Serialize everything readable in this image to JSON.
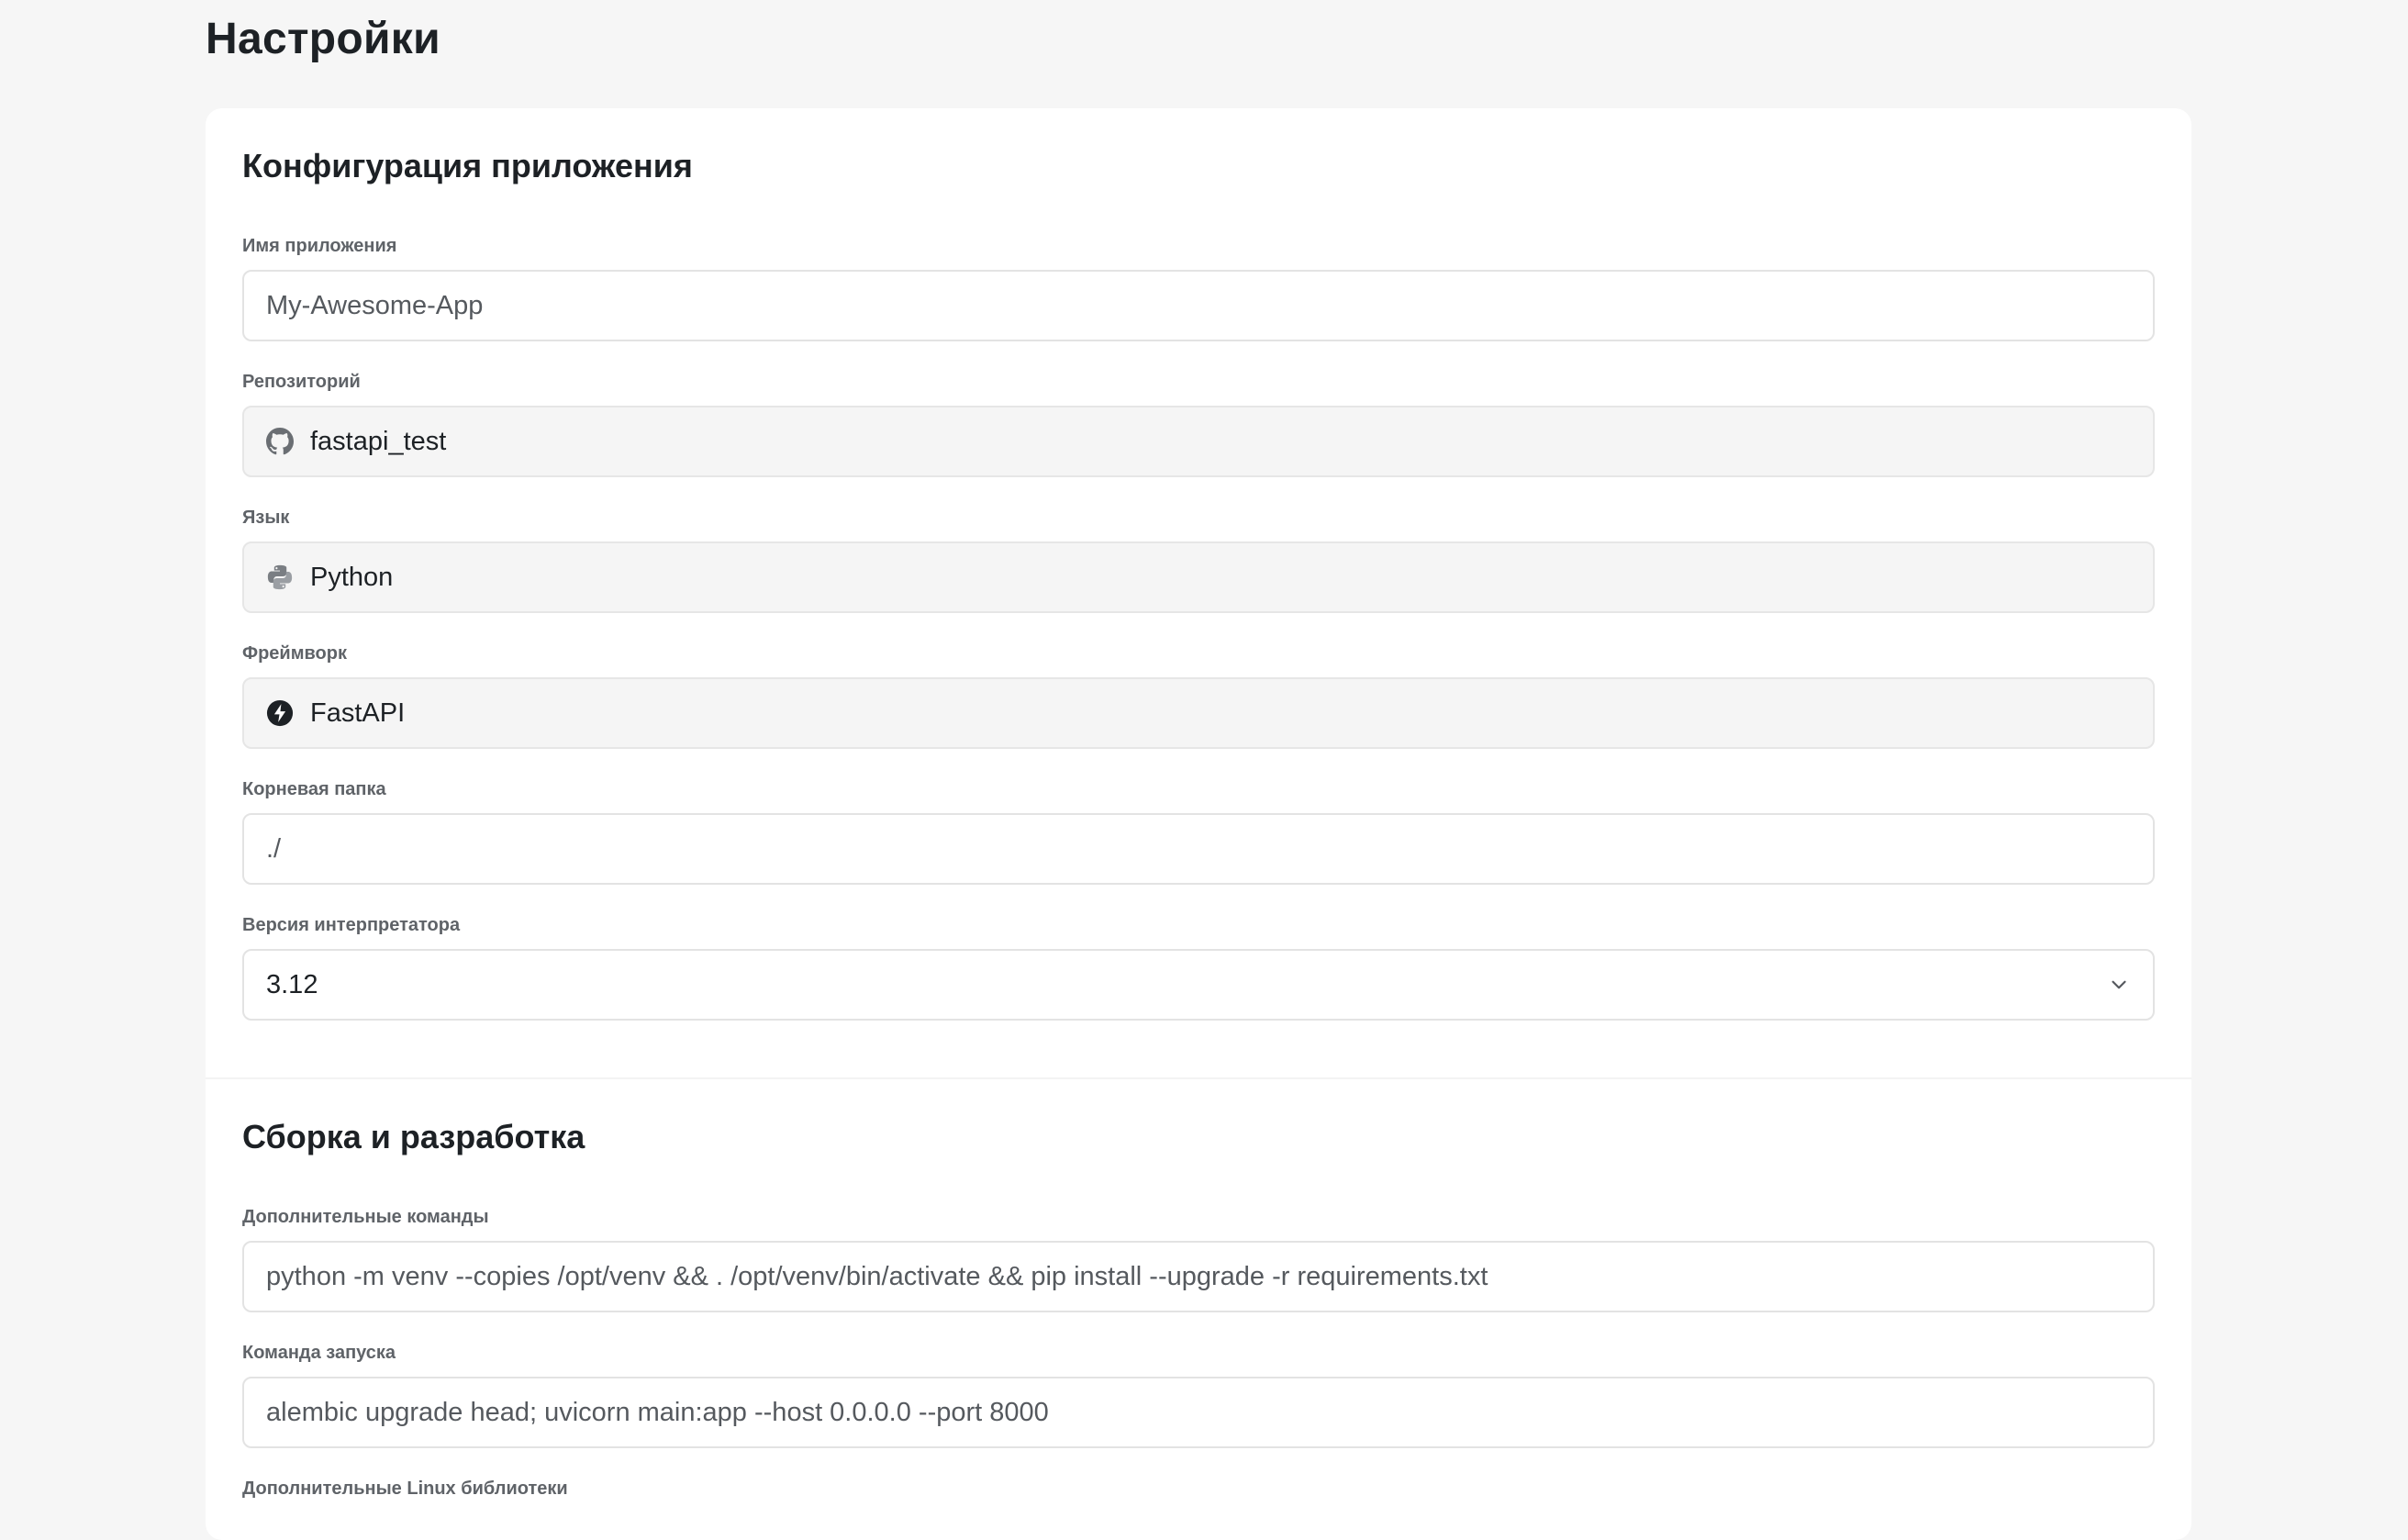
{
  "page": {
    "title": "Настройки"
  },
  "app_config": {
    "title": "Конфигурация приложения",
    "app_name": {
      "label": "Имя приложения",
      "value": "My-Awesome-App"
    },
    "repository": {
      "label": "Репозиторий",
      "value": "fastapi_test",
      "icon": "github-icon"
    },
    "language": {
      "label": "Язык",
      "value": "Python",
      "icon": "python-icon"
    },
    "framework": {
      "label": "Фреймворк",
      "value": "FastAPI",
      "icon": "fastapi-icon"
    },
    "root_folder": {
      "label": "Корневая папка",
      "value": "./"
    },
    "interpreter_version": {
      "label": "Версия интерпретатора",
      "value": "3.12"
    }
  },
  "build": {
    "title": "Сборка и разработка",
    "extra_commands": {
      "label": "Дополнительные команды",
      "value": "python -m venv --copies /opt/venv && . /opt/venv/bin/activate && pip install --upgrade -r requirements.txt"
    },
    "start_command": {
      "label": "Команда запуска",
      "value": "alembic upgrade head; uvicorn main:app --host 0.0.0.0 --port 8000"
    },
    "linux_libs": {
      "label": "Дополнительные Linux библиотеки"
    }
  },
  "colors": {
    "background": "#f6f6f6",
    "card": "#ffffff",
    "readonly_field": "#f5f5f5",
    "border": "#e3e3e3",
    "text": "#1d2125",
    "label": "#5f6368"
  }
}
